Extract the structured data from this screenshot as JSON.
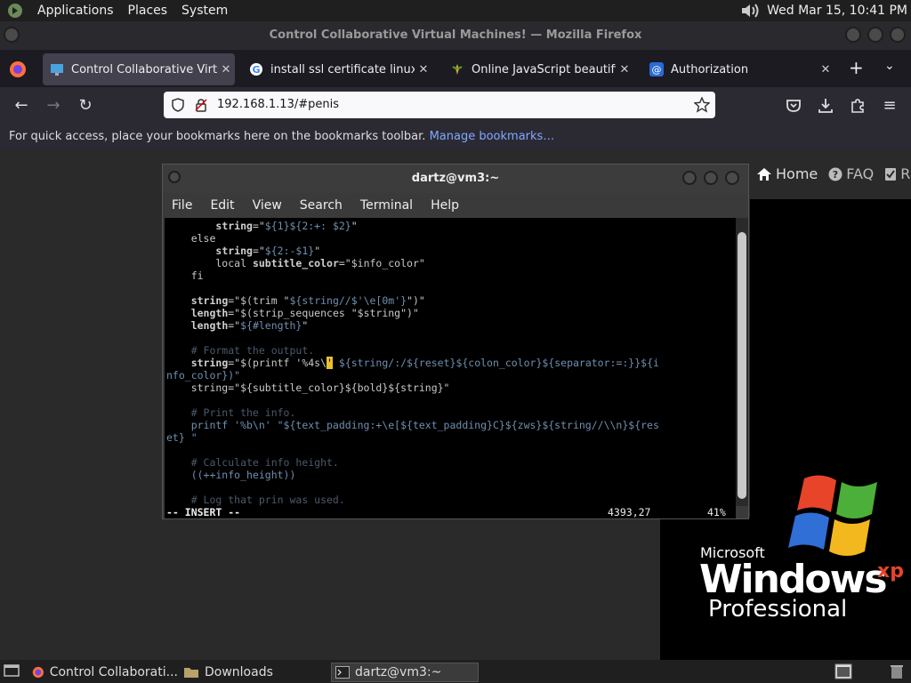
{
  "top_panel": {
    "menus": [
      "Applications",
      "Places",
      "System"
    ],
    "datetime": "Wed Mar 15, 10:41 PM"
  },
  "firefox": {
    "window_title": "Control Collaborative Virtual Machines! — Mozilla Firefox",
    "tabs": [
      {
        "label": "Control Collaborative Virtual Machines!",
        "active": true
      },
      {
        "label": "install ssl certificate linux - Google Search",
        "active": false
      },
      {
        "label": "Online JavaScript beautifier",
        "active": false
      },
      {
        "label": "Authorization",
        "active": false
      }
    ],
    "url": "192.168.1.13/#penis",
    "bookmarks_prompt": "For quick access, place your bookmarks here on the bookmarks toolbar.",
    "bookmarks_link": "Manage bookmarks…"
  },
  "page": {
    "nav": [
      "Home",
      "FAQ",
      "R"
    ]
  },
  "xp_logo": {
    "microsoft": "Microsoft",
    "windows": "Windows",
    "xp": "xp",
    "edition": "Professional"
  },
  "terminal": {
    "title": "dartz@vm3:~",
    "menu": [
      "File",
      "Edit",
      "View",
      "Search",
      "Terminal",
      "Help"
    ],
    "status_mode": "-- INSERT --",
    "status_pos": "4393,27",
    "status_pct": "41%"
  },
  "code": [
    {
      "seg": [
        [
          "        ",
          "w"
        ],
        [
          "string",
          "k"
        ],
        [
          "=\"",
          "w"
        ],
        [
          "${1}${2:+: $2}",
          "c"
        ],
        [
          "\"",
          "w"
        ]
      ]
    },
    {
      "seg": [
        [
          "    else",
          "w"
        ]
      ]
    },
    {
      "seg": [
        [
          "        ",
          "w"
        ],
        [
          "string",
          "k"
        ],
        [
          "=\"",
          "w"
        ],
        [
          "${2:-$1}",
          "c"
        ],
        [
          "\"",
          "w"
        ]
      ]
    },
    {
      "seg": [
        [
          "        local ",
          "w"
        ],
        [
          "subtitle_color",
          "k"
        ],
        [
          "=\"$info_color\"",
          "w"
        ]
      ]
    },
    {
      "seg": [
        [
          "    fi",
          "w"
        ]
      ]
    },
    {
      "seg": [
        [
          "",
          "w"
        ]
      ]
    },
    {
      "seg": [
        [
          "    ",
          "w"
        ],
        [
          "string",
          "k"
        ],
        [
          "=\"$(trim \"",
          "w"
        ],
        [
          "${string//$'\\e[0m'}",
          "c"
        ],
        [
          "\")\"",
          "w"
        ]
      ]
    },
    {
      "seg": [
        [
          "    ",
          "w"
        ],
        [
          "length",
          "k"
        ],
        [
          "=\"$(strip_sequences \"$string\")\"",
          "w"
        ]
      ]
    },
    {
      "seg": [
        [
          "    ",
          "w"
        ],
        [
          "length",
          "k"
        ],
        [
          "=\"",
          "w"
        ],
        [
          "${#length}",
          "c"
        ],
        [
          "\"",
          "w"
        ]
      ]
    },
    {
      "seg": [
        [
          "",
          "w"
        ]
      ]
    },
    {
      "seg": [
        [
          "    # Format the output.",
          "g"
        ]
      ]
    },
    {
      "seg": [
        [
          "    ",
          "w"
        ],
        [
          "string",
          "k"
        ],
        [
          "=\"$(printf '%4s\\",
          "w"
        ],
        [
          "'",
          "cur"
        ],
        [
          " ${string/:/${reset}${colon_color}${separator:=:}}${i",
          "c"
        ]
      ]
    },
    {
      "seg": [
        [
          "nfo_color})\"",
          "c"
        ]
      ]
    },
    {
      "seg": [
        [
          "    string=\"${subtitle_color}${bold}${string}\"",
          "w"
        ]
      ]
    },
    {
      "seg": [
        [
          "",
          "w"
        ]
      ]
    },
    {
      "seg": [
        [
          "    # Print the info.",
          "g"
        ]
      ]
    },
    {
      "seg": [
        [
          "    printf '%b\\n' \"${text_padding:+\\e[${text_padding}C}${zws}${string//\\\\n}${res",
          "c"
        ]
      ]
    },
    {
      "seg": [
        [
          "et} \"",
          "c"
        ]
      ]
    },
    {
      "seg": [
        [
          "",
          "w"
        ]
      ]
    },
    {
      "seg": [
        [
          "    # Calculate info height.",
          "g"
        ]
      ]
    },
    {
      "seg": [
        [
          "    ((++info_height))",
          "c"
        ]
      ]
    },
    {
      "seg": [
        [
          "",
          "w"
        ]
      ]
    },
    {
      "seg": [
        [
          "    # Log that prin was used.",
          "g"
        ]
      ]
    }
  ],
  "taskbar": {
    "items": [
      "Control Collaborati...",
      "Downloads",
      "dartz@vm3:~"
    ]
  },
  "colors": {
    "accent_link": "#80a8ff",
    "xp_red": "#e8442a",
    "xp_green": "#4caf3a",
    "xp_blue": "#2f6fd6",
    "xp_yellow": "#f2b81d"
  }
}
